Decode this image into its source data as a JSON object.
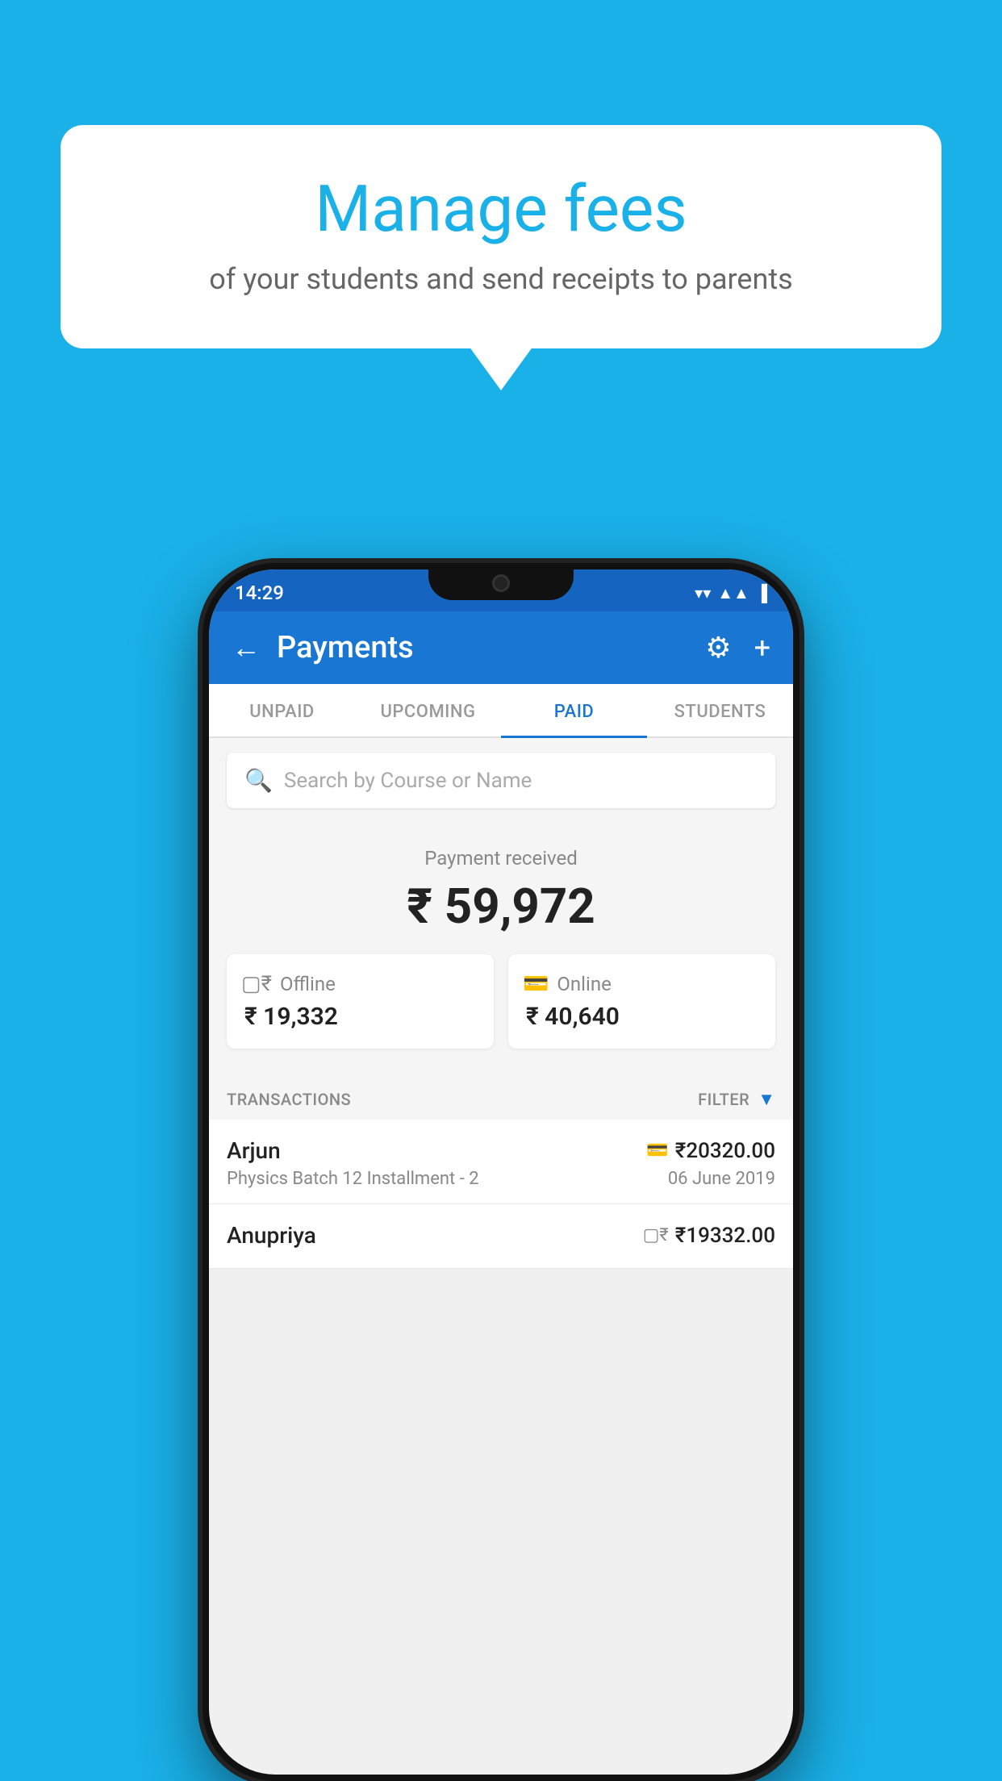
{
  "background_color": "#1ab0e8",
  "speech_bubble": {
    "title": "Manage fees",
    "subtitle": "of your students and send receipts to parents"
  },
  "status_bar": {
    "time": "14:29",
    "wifi": "▼",
    "signal": "▲",
    "battery": "▌"
  },
  "app_bar": {
    "title": "Payments",
    "back_label": "←",
    "gear_label": "⚙",
    "plus_label": "+"
  },
  "tabs": [
    {
      "label": "UNPAID",
      "active": false
    },
    {
      "label": "UPCOMING",
      "active": false
    },
    {
      "label": "PAID",
      "active": true
    },
    {
      "label": "STUDENTS",
      "active": false
    }
  ],
  "search": {
    "placeholder": "Search by Course or Name"
  },
  "payment_summary": {
    "received_label": "Payment received",
    "total_amount": "₹ 59,972",
    "offline": {
      "label": "Offline",
      "amount": "₹ 19,332"
    },
    "online": {
      "label": "Online",
      "amount": "₹ 40,640"
    }
  },
  "transactions": {
    "header_label": "TRANSACTIONS",
    "filter_label": "FILTER",
    "rows": [
      {
        "name": "Arjun",
        "description": "Physics Batch 12 Installment - 2",
        "amount": "₹20320.00",
        "date": "06 June 2019",
        "payment_type": "online"
      },
      {
        "name": "Anupriya",
        "description": "",
        "amount": "₹19332.00",
        "date": "",
        "payment_type": "offline"
      }
    ]
  }
}
